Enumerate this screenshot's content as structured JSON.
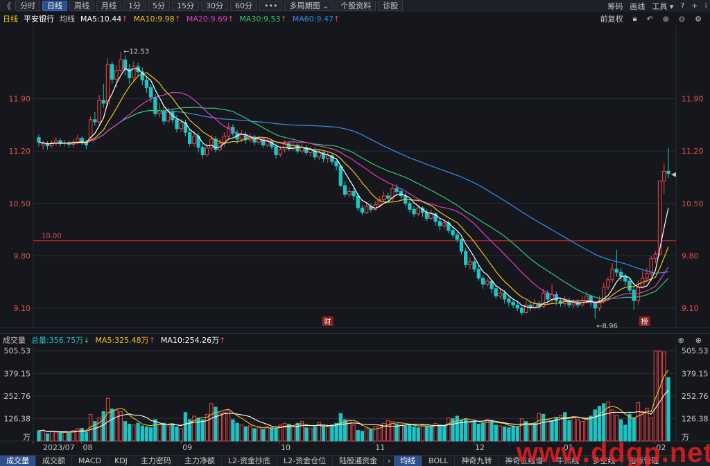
{
  "toolbar": {
    "back_glyph": "《",
    "tabs": [
      "分时",
      "日线",
      "周线",
      "月线",
      "1分",
      "5分",
      "15分",
      "30分",
      "60分",
      "•••",
      "多周期图 ⌄",
      "个股资料",
      "诊股"
    ],
    "active_tab": "日线",
    "right_items": [
      "筹码",
      "画线",
      "工具 ▾"
    ],
    "right_icons": [
      "help-icon",
      "add-icon",
      "grid-icon"
    ]
  },
  "indicator_header": {
    "period": "日线",
    "stock_name": "平安银行",
    "ma_label": "均线",
    "ma5": "MA5:10.44",
    "ma10": "MA10:9.98",
    "ma20": "MA20:9.69",
    "ma30": "MA30:9.53",
    "ma60": "MA60:9.47",
    "adjust": "前复权",
    "right_icons": [
      "lock-icon",
      "undo-icon",
      "zoom-in-icon",
      "zoom-out-icon",
      "settings-icon"
    ]
  },
  "colors": {
    "up": "#f04848",
    "down": "#1ec3c3",
    "ma5": "#ffffff",
    "ma10": "#f0c419",
    "ma20": "#e040c0",
    "ma30": "#2ecc71",
    "ma60": "#3a8ee6",
    "ref_line": "#e03030"
  },
  "chart_data": {
    "type": "candlestick",
    "price_axis": {
      "ticks": [
        9.1,
        9.8,
        10.5,
        11.2,
        11.9
      ],
      "tick_labels": [
        "9.10",
        "9.80",
        "10.50",
        "11.20",
        "11.90"
      ],
      "ylim": [
        8.84,
        12.85
      ]
    },
    "reference_line": {
      "value": 10.0,
      "label": "10.00"
    },
    "annotations": [
      {
        "label": "12.53",
        "value": 12.53,
        "type": "high"
      },
      {
        "label": "8.96",
        "value": 8.96,
        "type": "low"
      },
      {
        "label": "财",
        "type": "event"
      },
      {
        "label": "榜",
        "type": "event"
      }
    ],
    "x_labels": [
      "2023/07",
      "08",
      "09",
      "10",
      "11",
      "12",
      "01",
      "02"
    ],
    "volume": {
      "header_label": "成交量",
      "total": "总量:356.75万",
      "ma5": "MA5:325.48万",
      "ma10": "MA10:254.26万",
      "ticks": [
        126.38,
        252.76,
        379.15,
        505.53
      ],
      "tick_labels": [
        "126.38",
        "252.76",
        "379.15",
        "505.53"
      ],
      "unit": "万",
      "ylim": [
        0,
        520
      ]
    },
    "ohlc": [
      [
        11.38,
        11.32,
        11.42,
        11.26
      ],
      [
        11.28,
        11.3,
        11.34,
        11.22
      ],
      [
        11.3,
        11.27,
        11.33,
        11.22
      ],
      [
        11.27,
        11.31,
        11.35,
        11.24
      ],
      [
        11.31,
        11.34,
        11.38,
        11.27
      ],
      [
        11.34,
        11.3,
        11.37,
        11.26
      ],
      [
        11.3,
        11.31,
        11.35,
        11.26
      ],
      [
        11.31,
        11.29,
        11.34,
        11.24
      ],
      [
        11.29,
        11.32,
        11.36,
        11.25
      ],
      [
        11.32,
        11.37,
        11.42,
        11.29
      ],
      [
        11.37,
        11.32,
        11.4,
        11.28
      ],
      [
        11.32,
        11.28,
        11.35,
        11.23
      ],
      [
        11.35,
        11.62,
        11.66,
        11.33
      ],
      [
        11.62,
        11.59,
        11.72,
        11.54
      ],
      [
        11.59,
        11.88,
        11.95,
        11.55
      ],
      [
        11.88,
        11.84,
        12.1,
        11.78
      ],
      [
        11.84,
        12.36,
        12.44,
        11.8
      ],
      [
        12.36,
        12.16,
        12.4,
        12.1
      ],
      [
        12.16,
        12.28,
        12.35,
        12.05
      ],
      [
        12.28,
        12.42,
        12.53,
        12.25
      ],
      [
        12.42,
        12.3,
        12.48,
        12.22
      ],
      [
        12.3,
        12.18,
        12.36,
        12.1
      ],
      [
        12.18,
        12.33,
        12.4,
        12.12
      ],
      [
        12.33,
        12.26,
        12.38,
        12.2
      ],
      [
        12.26,
        12.15,
        12.32,
        12.08
      ],
      [
        12.15,
        12.05,
        12.2,
        11.98
      ],
      [
        12.05,
        11.92,
        12.1,
        11.85
      ],
      [
        11.92,
        11.7,
        11.96,
        11.66
      ],
      [
        11.7,
        11.74,
        11.84,
        11.65
      ],
      [
        11.74,
        11.6,
        11.8,
        11.55
      ],
      [
        11.6,
        11.72,
        11.78,
        11.58
      ],
      [
        11.72,
        11.62,
        11.76,
        11.57
      ],
      [
        11.62,
        11.5,
        11.68,
        11.45
      ],
      [
        11.5,
        11.58,
        11.63,
        11.46
      ],
      [
        11.58,
        11.45,
        11.62,
        11.4
      ],
      [
        11.45,
        11.3,
        11.5,
        11.26
      ],
      [
        11.3,
        11.4,
        11.46,
        11.26
      ],
      [
        11.4,
        11.25,
        11.44,
        11.18
      ],
      [
        11.25,
        11.15,
        11.3,
        11.1
      ],
      [
        11.15,
        11.24,
        11.3,
        11.12
      ],
      [
        11.24,
        11.36,
        11.42,
        11.2
      ],
      [
        11.36,
        11.22,
        11.4,
        11.18
      ],
      [
        11.22,
        11.3,
        11.36,
        11.2
      ],
      [
        11.3,
        11.4,
        11.45,
        11.26
      ],
      [
        11.4,
        11.52,
        11.58,
        11.36
      ],
      [
        11.52,
        11.44,
        11.56,
        11.4
      ],
      [
        11.44,
        11.36,
        11.48,
        11.3
      ],
      [
        11.36,
        11.42,
        11.48,
        11.32
      ],
      [
        11.42,
        11.35,
        11.46,
        11.3
      ],
      [
        11.35,
        11.39,
        11.44,
        11.31
      ],
      [
        11.39,
        11.32,
        11.42,
        11.27
      ],
      [
        11.32,
        11.36,
        11.4,
        11.28
      ],
      [
        11.36,
        11.28,
        11.38,
        11.24
      ],
      [
        11.28,
        11.33,
        11.37,
        11.25
      ],
      [
        11.33,
        11.26,
        11.36,
        11.22
      ],
      [
        11.26,
        11.15,
        11.3,
        11.1
      ],
      [
        11.15,
        11.22,
        11.27,
        11.12
      ],
      [
        11.22,
        11.3,
        11.35,
        11.18
      ],
      [
        11.3,
        11.24,
        11.33,
        11.2
      ],
      [
        11.24,
        11.28,
        11.32,
        11.2
      ],
      [
        11.28,
        11.2,
        11.3,
        11.16
      ],
      [
        11.2,
        11.25,
        11.3,
        11.17
      ],
      [
        11.25,
        11.18,
        11.28,
        11.14
      ],
      [
        11.18,
        11.22,
        11.26,
        11.13
      ],
      [
        11.22,
        11.12,
        11.25,
        11.08
      ],
      [
        11.12,
        11.18,
        11.22,
        11.08
      ],
      [
        11.18,
        11.1,
        11.2,
        11.05
      ],
      [
        11.1,
        11.14,
        11.18,
        11.04
      ],
      [
        11.14,
        11.06,
        11.16,
        11.02
      ],
      [
        11.06,
        11.0,
        11.1,
        10.94
      ],
      [
        11.0,
        10.74,
        11.02,
        10.72
      ],
      [
        10.74,
        10.62,
        10.8,
        10.58
      ],
      [
        10.62,
        10.66,
        10.72,
        10.58
      ],
      [
        10.66,
        10.6,
        10.7,
        10.54
      ],
      [
        10.6,
        10.44,
        10.64,
        10.4
      ],
      [
        10.44,
        10.38,
        10.48,
        10.34
      ],
      [
        10.38,
        10.46,
        10.52,
        10.36
      ],
      [
        10.46,
        10.42,
        10.5,
        10.38
      ],
      [
        10.42,
        10.48,
        10.53,
        10.4
      ],
      [
        10.48,
        10.55,
        10.6,
        10.44
      ],
      [
        10.55,
        10.6,
        10.66,
        10.52
      ],
      [
        10.6,
        10.57,
        10.64,
        10.52
      ],
      [
        10.57,
        10.7,
        10.74,
        10.53
      ],
      [
        10.7,
        10.66,
        10.76,
        10.62
      ],
      [
        10.66,
        10.6,
        10.7,
        10.56
      ],
      [
        10.6,
        10.5,
        10.64,
        10.46
      ],
      [
        10.5,
        10.42,
        10.54,
        10.38
      ],
      [
        10.42,
        10.36,
        10.46,
        10.32
      ],
      [
        10.36,
        10.44,
        10.48,
        10.33
      ],
      [
        10.44,
        10.38,
        10.46,
        10.32
      ],
      [
        10.38,
        10.3,
        10.42,
        10.26
      ],
      [
        10.3,
        10.36,
        10.42,
        10.28
      ],
      [
        10.36,
        10.26,
        10.38,
        10.2
      ],
      [
        10.26,
        10.2,
        10.3,
        10.14
      ],
      [
        10.2,
        10.24,
        10.28,
        10.16
      ],
      [
        10.24,
        10.14,
        10.27,
        10.1
      ],
      [
        10.14,
        10.08,
        10.18,
        10.04
      ],
      [
        10.08,
        10.02,
        10.12,
        9.98
      ],
      [
        10.02,
        9.86,
        10.04,
        9.82
      ],
      [
        9.86,
        9.68,
        9.9,
        9.64
      ],
      [
        9.68,
        9.72,
        9.78,
        9.62
      ],
      [
        9.72,
        9.62,
        9.76,
        9.58
      ],
      [
        9.62,
        9.5,
        9.66,
        9.46
      ],
      [
        9.5,
        9.42,
        9.54,
        9.36
      ],
      [
        9.42,
        9.46,
        9.5,
        9.38
      ],
      [
        9.46,
        9.36,
        9.48,
        9.3
      ],
      [
        9.36,
        9.26,
        9.4,
        9.22
      ],
      [
        9.26,
        9.3,
        9.36,
        9.22
      ],
      [
        9.3,
        9.22,
        9.34,
        9.16
      ],
      [
        9.22,
        9.18,
        9.26,
        9.12
      ],
      [
        9.18,
        9.14,
        9.22,
        9.1
      ],
      [
        9.14,
        9.1,
        9.18,
        9.06
      ],
      [
        9.1,
        9.04,
        9.14,
        9.0
      ],
      [
        9.04,
        9.14,
        9.2,
        9.02
      ],
      [
        9.14,
        9.1,
        9.18,
        9.06
      ],
      [
        9.1,
        9.16,
        9.22,
        9.08
      ],
      [
        9.16,
        9.12,
        9.2,
        9.08
      ],
      [
        9.12,
        9.3,
        9.36,
        9.1
      ],
      [
        9.3,
        9.22,
        9.34,
        9.16
      ],
      [
        9.22,
        9.28,
        9.42,
        9.18
      ],
      [
        9.28,
        9.2,
        9.32,
        9.14
      ],
      [
        9.2,
        9.16,
        9.24,
        9.12
      ],
      [
        9.16,
        9.2,
        9.26,
        9.12
      ],
      [
        9.2,
        9.14,
        9.24,
        9.1
      ],
      [
        9.14,
        9.18,
        9.22,
        9.1
      ],
      [
        9.18,
        9.14,
        9.22,
        9.1
      ],
      [
        9.14,
        9.2,
        9.26,
        9.12
      ],
      [
        9.2,
        9.26,
        9.32,
        9.16
      ],
      [
        9.26,
        9.18,
        9.28,
        9.12
      ],
      [
        9.18,
        9.1,
        9.2,
        8.96
      ],
      [
        9.1,
        9.2,
        9.26,
        9.06
      ],
      [
        9.2,
        9.38,
        9.44,
        9.16
      ],
      [
        9.38,
        9.48,
        9.52,
        9.34
      ],
      [
        9.48,
        9.62,
        9.7,
        9.44
      ],
      [
        9.62,
        9.58,
        9.88,
        9.52
      ],
      [
        9.58,
        9.52,
        9.64,
        9.46
      ],
      [
        9.52,
        9.46,
        9.56,
        9.4
      ],
      [
        9.46,
        9.34,
        9.5,
        9.3
      ],
      [
        9.34,
        9.2,
        9.4,
        9.08
      ],
      [
        9.2,
        9.38,
        9.48,
        9.14
      ],
      [
        9.38,
        9.5,
        9.6,
        9.36
      ],
      [
        9.5,
        9.56,
        9.64,
        9.44
      ],
      [
        9.56,
        9.76,
        9.8,
        9.52
      ],
      [
        9.76,
        9.82,
        9.86,
        9.7
      ],
      [
        9.82,
        10.8,
        10.8,
        9.8
      ],
      [
        10.8,
        10.93,
        11.04,
        10.62
      ],
      [
        10.93,
        10.9,
        11.24,
        10.84
      ]
    ],
    "vol": [
      58,
      62,
      40,
      55,
      50,
      48,
      52,
      45,
      60,
      70,
      72,
      48,
      150,
      110,
      130,
      165,
      240,
      180,
      175,
      165,
      110,
      95,
      90,
      100,
      85,
      80,
      75,
      120,
      95,
      100,
      85,
      90,
      80,
      70,
      160,
      120,
      140,
      130,
      120,
      150,
      210,
      190,
      155,
      160,
      175,
      120,
      100,
      90,
      80,
      85,
      70,
      75,
      65,
      80,
      75,
      70,
      90,
      100,
      95,
      80,
      100,
      110,
      75,
      70,
      80,
      105,
      85,
      78,
      90,
      100,
      155,
      120,
      115,
      90,
      60,
      55,
      70,
      65,
      80,
      90,
      100,
      115,
      110,
      95,
      90,
      85,
      95,
      80,
      75,
      90,
      85,
      80,
      100,
      90,
      85,
      130,
      125,
      140,
      115,
      120,
      105,
      110,
      95,
      100,
      120,
      115,
      90,
      85,
      80,
      75,
      85,
      80,
      125,
      110,
      90,
      100,
      155,
      150,
      120,
      115,
      130,
      145,
      160,
      115,
      135,
      120,
      110,
      125,
      140,
      175,
      195,
      210,
      220,
      175,
      145,
      120,
      90,
      150,
      130,
      215,
      165,
      185,
      130,
      505,
      505,
      500,
      356
    ],
    "vol_up": [
      0,
      1,
      0,
      1,
      1,
      0,
      1,
      0,
      1,
      1,
      0,
      0,
      1,
      0,
      1,
      0,
      1,
      0,
      1,
      1,
      0,
      0,
      1,
      0,
      0,
      0,
      0,
      0,
      1,
      0,
      1,
      0,
      0,
      1,
      0,
      0,
      1,
      0,
      0,
      1,
      1,
      0,
      1,
      1,
      1,
      0,
      0,
      1,
      0,
      1,
      0,
      1,
      0,
      1,
      0,
      0,
      1,
      1,
      0,
      1,
      0,
      1,
      0,
      1,
      0,
      1,
      0,
      1,
      0,
      0,
      0,
      0,
      1,
      1,
      0,
      0,
      1,
      0,
      1,
      1,
      1,
      1,
      1,
      0,
      1,
      0,
      0,
      0,
      0,
      1,
      0,
      0,
      1,
      0,
      0,
      1,
      0,
      0,
      0,
      0,
      1,
      0,
      0,
      0,
      1,
      0,
      0,
      1,
      0,
      0,
      0,
      0,
      1,
      0,
      1,
      0,
      1,
      0,
      1,
      0,
      0,
      1,
      0,
      0,
      1,
      1,
      1,
      1,
      0,
      0,
      0,
      0,
      1,
      1,
      1,
      0,
      0,
      0,
      0,
      1,
      1,
      1,
      1,
      1,
      1,
      1,
      0
    ]
  },
  "bottom_tabs": {
    "left": [
      "成交量",
      "成交额",
      "MACD",
      "KDJ",
      "主力密码",
      "主力净额",
      "L2-资金抄底",
      "L2-资金仓位",
      "陆股通资金"
    ],
    "left_active": "成交量",
    "nav": "›",
    "right": [
      "均线",
      "BOLL",
      "神奇九转",
      "神奇五线谱",
      "牛熊线",
      "多空线",
      "指标管理"
    ],
    "right_active": "均线"
  },
  "watermark": "www.ddgp.net"
}
